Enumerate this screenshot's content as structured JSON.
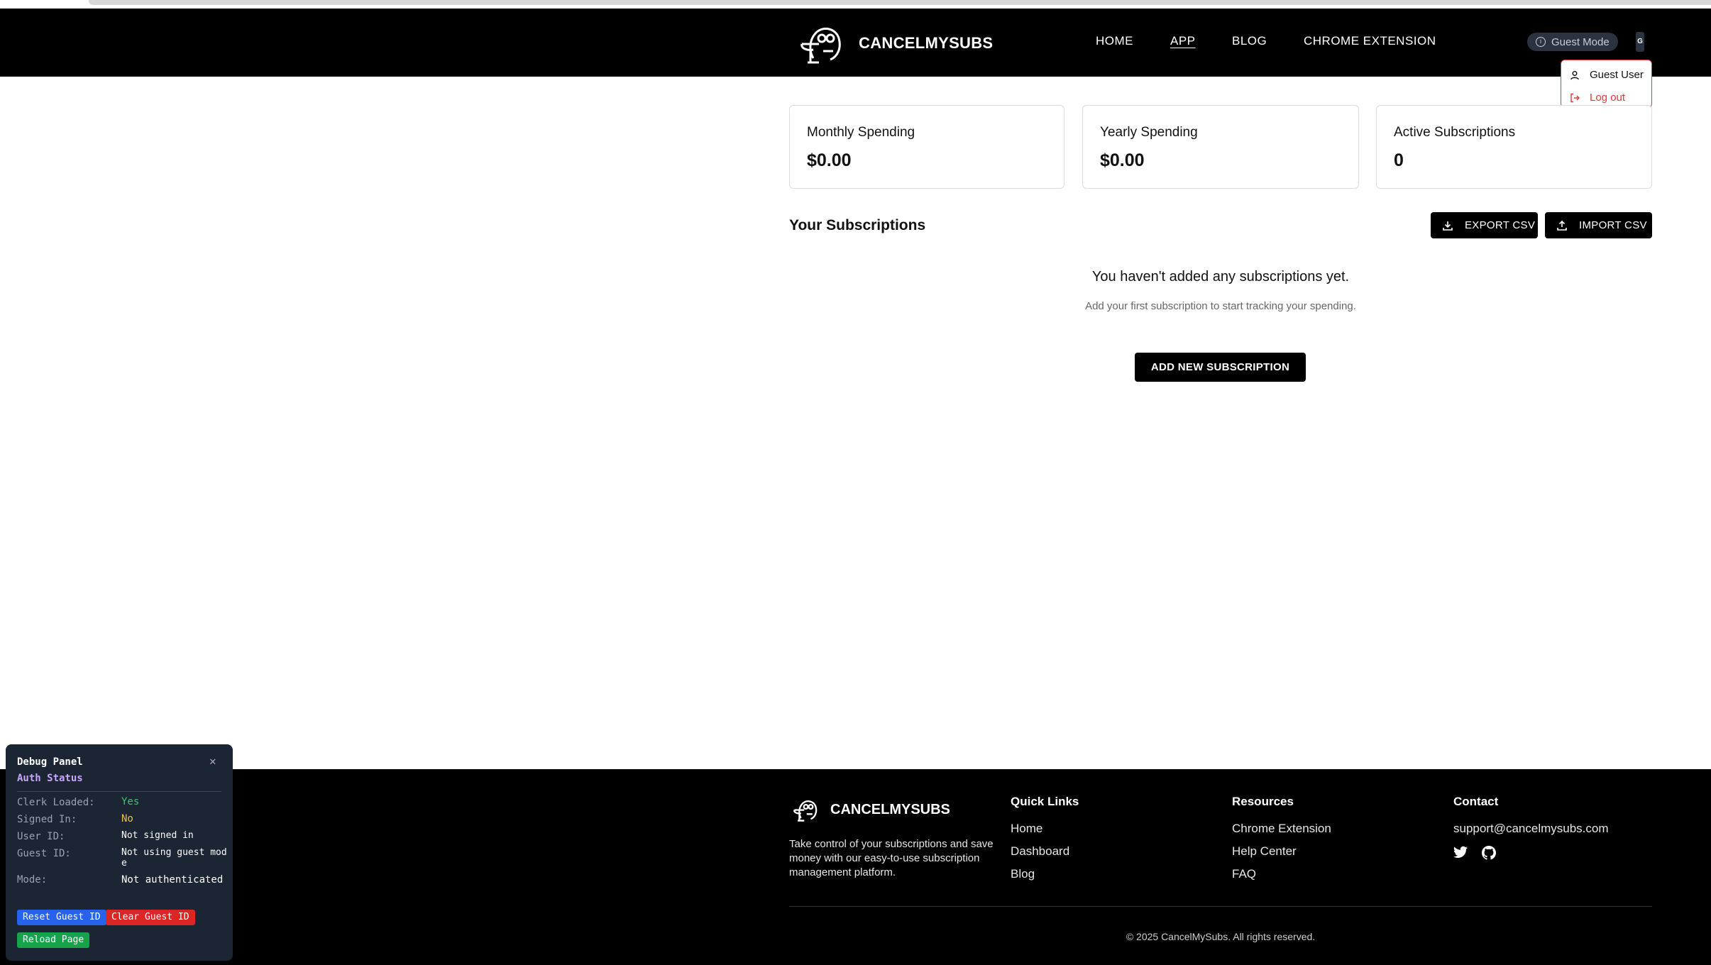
{
  "header": {
    "brand": "CANCELMYSUBS",
    "nav": [
      {
        "label": "HOME"
      },
      {
        "label": "APP"
      },
      {
        "label": "BLOG"
      },
      {
        "label": "CHROME EXTENSION"
      }
    ],
    "guest_mode_label": "Guest Mode",
    "avatar_initial": "G"
  },
  "user_menu": {
    "user_label": "Guest User",
    "logout_label": "Log out"
  },
  "stats": [
    {
      "label": "Monthly Spending",
      "value": "$0.00"
    },
    {
      "label": "Yearly Spending",
      "value": "$0.00"
    },
    {
      "label": "Active Subscriptions",
      "value": "0"
    }
  ],
  "subscriptions": {
    "title": "Your Subscriptions",
    "export_label": "EXPORT CSV",
    "import_label": "IMPORT CSV",
    "empty_heading": "You haven't added any subscriptions yet.",
    "empty_subtext": "Add your first subscription to start tracking your spending.",
    "add_label": "ADD NEW SUBSCRIPTION"
  },
  "footer": {
    "brand": "CANCELMYSUBS",
    "description": "Take control of your subscriptions and save money with our easy-to-use subscription management platform.",
    "quick_links": {
      "title": "Quick Links",
      "items": [
        "Home",
        "Dashboard",
        "Blog"
      ]
    },
    "resources": {
      "title": "Resources",
      "items": [
        "Chrome Extension",
        "Help Center",
        "FAQ"
      ]
    },
    "contact": {
      "title": "Contact",
      "email": "support@cancelmysubs.com",
      "icons": [
        "twitter-icon",
        "github-icon"
      ]
    },
    "copyright": "© 2025 CancelMySubs. All rights reserved."
  },
  "debug_panel": {
    "title": "Debug Panel",
    "section": "Auth Status",
    "rows": [
      {
        "key": "Clerk Loaded:",
        "value": "Yes"
      },
      {
        "key": "Signed In:",
        "value": "No"
      },
      {
        "key": "User ID:",
        "value": "Not signed in"
      },
      {
        "key": "Guest ID:",
        "value": "Not using guest mode"
      },
      {
        "key": "Mode:",
        "value": "Not authenticated"
      }
    ],
    "buttons": {
      "reset": "Reset Guest ID",
      "clear": "Clear Guest ID",
      "reload": "Reload Page"
    }
  },
  "colors": {
    "accent_red": "#e03a3a",
    "debug_bg": "#1c2533",
    "yes_green": "#41c46b",
    "no_yellow": "#e6c34a",
    "reset_blue": "#2563eb",
    "clear_red": "#dc2626",
    "reload_green": "#16a34a"
  }
}
